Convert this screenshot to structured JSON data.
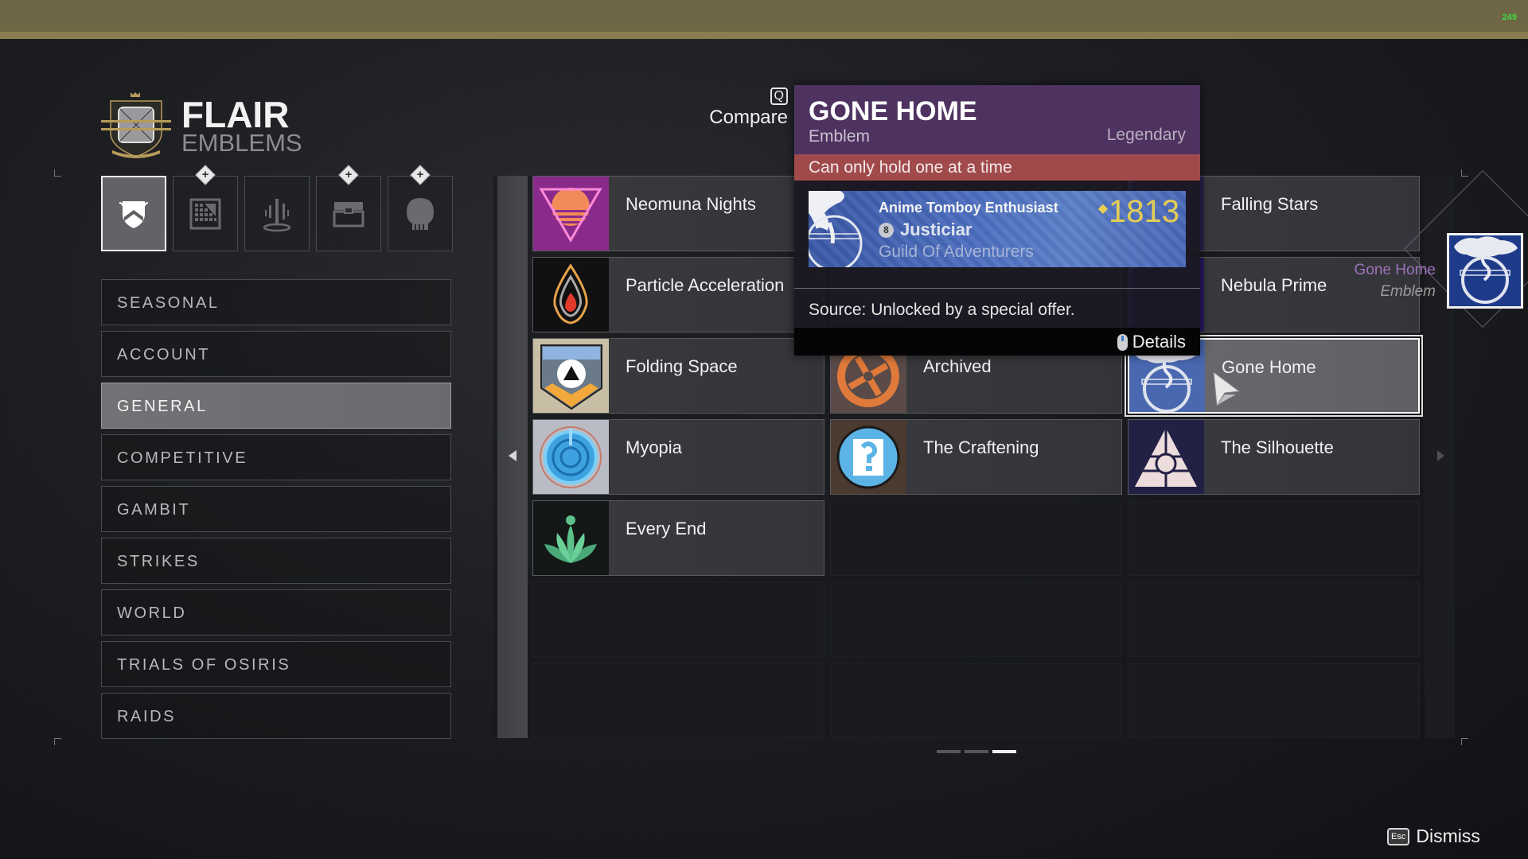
{
  "system": {
    "fps_counter": "249"
  },
  "header": {
    "title": "FLAIR",
    "subtitle": "EMBLEMS",
    "icon": "flair-crest-icon"
  },
  "category_tabs": [
    {
      "name": "emblems",
      "icon": "shield-emblem-icon",
      "active": true,
      "has_new_badge": false
    },
    {
      "name": "shaders",
      "icon": "shader-grid-icon",
      "active": false,
      "has_new_badge": true
    },
    {
      "name": "transmat-effects",
      "icon": "transmat-effect-icon",
      "active": false,
      "has_new_badge": false
    },
    {
      "name": "ships",
      "icon": "chest-icon",
      "active": false,
      "has_new_badge": true
    },
    {
      "name": "ghost-shells",
      "icon": "ghost-shell-icon",
      "active": false,
      "has_new_badge": true
    }
  ],
  "sidebar": {
    "selected": "GENERAL",
    "items": [
      {
        "label": "SEASONAL"
      },
      {
        "label": "ACCOUNT"
      },
      {
        "label": "GENERAL"
      },
      {
        "label": "COMPETITIVE"
      },
      {
        "label": "GAMBIT"
      },
      {
        "label": "STRIKES"
      },
      {
        "label": "WORLD"
      },
      {
        "label": "TRIALS OF OSIRIS"
      },
      {
        "label": "RAIDS"
      }
    ]
  },
  "grid": {
    "columns": [
      [
        {
          "name": "Neomuna Nights",
          "icon": "synthwave-triangle-icon"
        },
        {
          "name": "Particle Acceleration",
          "icon": "flame-drop-icon"
        },
        {
          "name": "Folding Space",
          "icon": "folding-space-crest-icon"
        },
        {
          "name": "Myopia",
          "icon": "lens-circle-icon"
        },
        {
          "name": "Every End",
          "icon": "lotus-icon"
        }
      ],
      [
        {
          "name": "",
          "icon": "obscured",
          "obscured": true
        },
        {
          "name": "",
          "icon": "obscured",
          "obscured": true
        },
        {
          "name": "Archived",
          "icon": "archive-cross-icon"
        },
        {
          "name": "The Craftening",
          "icon": "puzzle-question-icon"
        }
      ],
      [
        {
          "name": "Falling Stars",
          "icon": "falling-stars-icon"
        },
        {
          "name": "Nebula Prime",
          "icon": "nebula-icon"
        },
        {
          "name": "Gone Home",
          "icon": "tree-circle-icon",
          "selected": true
        },
        {
          "name": "The Silhouette",
          "icon": "triangle-pattern-icon"
        }
      ]
    ],
    "prev_page_icon": "chevron-left-icon",
    "next_page_icon": "chevron-right-icon"
  },
  "compare": {
    "key": "Q",
    "label": "Compare"
  },
  "tooltip": {
    "title": "GONE HOME",
    "type": "Emblem",
    "rarity": "Legendary",
    "warning": "Can only hold one at a time",
    "nameplate": {
      "player_name": "Anime Tomboy Enthusiast",
      "rank_number": "8",
      "rank_title": "Justiciar",
      "clan": "Guild Of Adventurers",
      "power_level": "1813"
    },
    "source": "Source: Unlocked by a special offer.",
    "details_label": "Details",
    "colors": {
      "header": "#4e3360",
      "warning": "#a14a4b",
      "power": "#e6cf52"
    }
  },
  "preview": {
    "name": "Gone Home",
    "type": "Emblem",
    "name_color": "#9e72b8"
  },
  "pager": {
    "pages": 3,
    "current": 3
  },
  "dismiss": {
    "key": "Esc",
    "label": "Dismiss"
  }
}
